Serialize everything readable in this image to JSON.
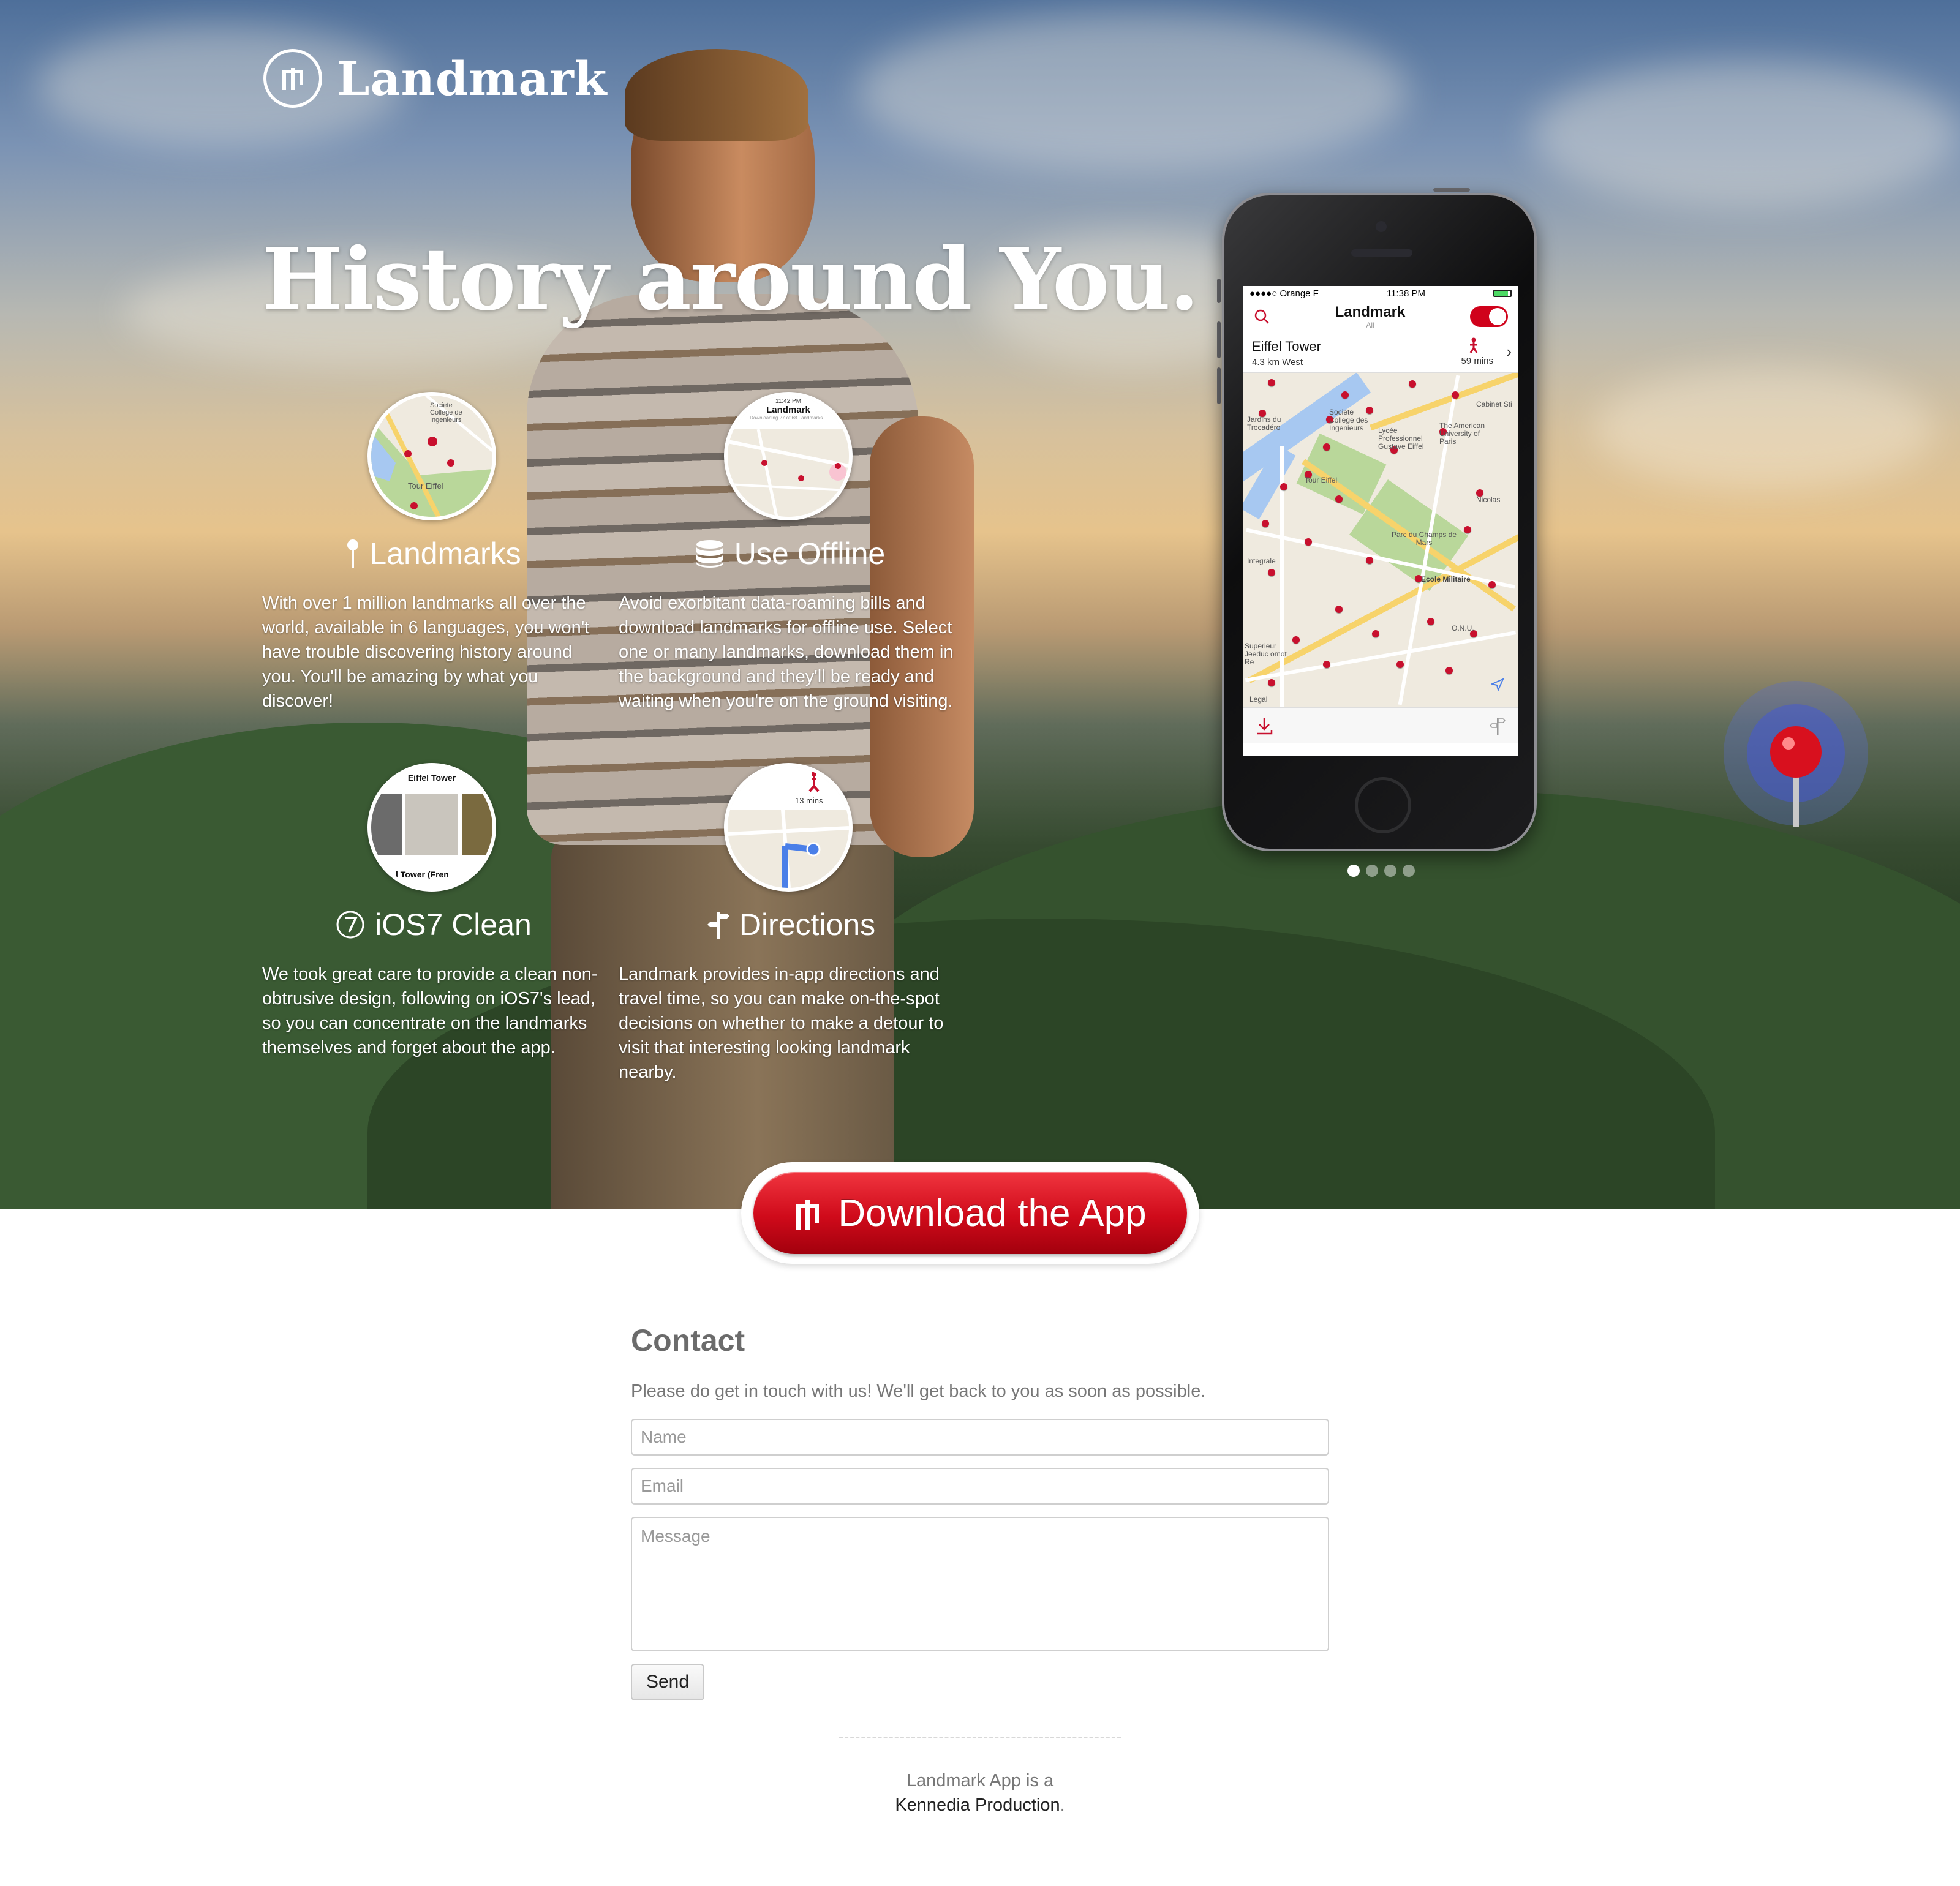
{
  "brand": {
    "name": "Landmark",
    "accent": "#d0021b"
  },
  "hero": {
    "headline": "History around You."
  },
  "features": [
    {
      "title": "Landmarks",
      "icon": "pin-icon",
      "description": "With over 1 million landmarks all over the world, available in 6 languages, you won't have trouble discovering history around you. You'll be amazing by what you discover!"
    },
    {
      "title": "Use Offline",
      "icon": "database-icon",
      "description": "Avoid exorbitant data-roaming bills and download landmarks for offline use. Select one or many landmarks, download them in the background and they'll be ready and waiting when you're on the ground visiting."
    },
    {
      "title": "iOS7 Clean",
      "icon": "seven-circle-icon",
      "description": "We took great care to provide a clean non-obtrusive design, following on iOS7's lead, so you can concentrate on the landmarks themselves and forget about the app."
    },
    {
      "title": "Directions",
      "icon": "signpost-icon",
      "description": "Landmark provides in-app directions and travel time, so you can make on-the-spot decisions on whether to make a detour to visit that interesting looking landmark nearby."
    }
  ],
  "thumbs": {
    "offline_time": "11:42 PM",
    "offline_title": "Landmark",
    "offline_sub": "Downloading 27 of 68 Landmarks...",
    "clean_title": "Eiffel Tower",
    "clean_caption": "l Tower (Fren",
    "directions_time": "13 mins",
    "landmarks_label1": "Societe College de Ingenieurs",
    "landmarks_label2": "Tour Eiffel"
  },
  "phone": {
    "carrier": "●●●●○ Orange F",
    "time": "11:38 PM",
    "app_title": "Landmark",
    "app_subtitle": "All",
    "poi_name": "Eiffel Tower",
    "poi_distance": "4.3 km West",
    "poi_time": "59 mins",
    "map_labels": [
      "Jardins du Trocadéro",
      "Societe College des Ingenieurs",
      "Lycée Professionnel Gustave Eiffel",
      "The American University of Paris",
      "Cabinet Sti",
      "Tour Eiffel",
      "Nicolas",
      "Parc du Champs de Mars",
      "Ecole Militaire",
      "O.N.U.",
      "Superieur Jeeduc omot Re",
      "Legal",
      "Integrale"
    ],
    "carousel_pages": 4,
    "carousel_active": 1
  },
  "download": {
    "label": "Download the App",
    "icon": "landmark-logo-icon"
  },
  "contact": {
    "heading": "Contact",
    "intro": "Please do get in touch with us! We'll get back to you as soon as possible.",
    "name_placeholder": "Name",
    "email_placeholder": "Email",
    "message_placeholder": "Message",
    "send_label": "Send"
  },
  "footer": {
    "line1": "Landmark App is a",
    "link": "Kennedia Production",
    "suffix": "."
  }
}
